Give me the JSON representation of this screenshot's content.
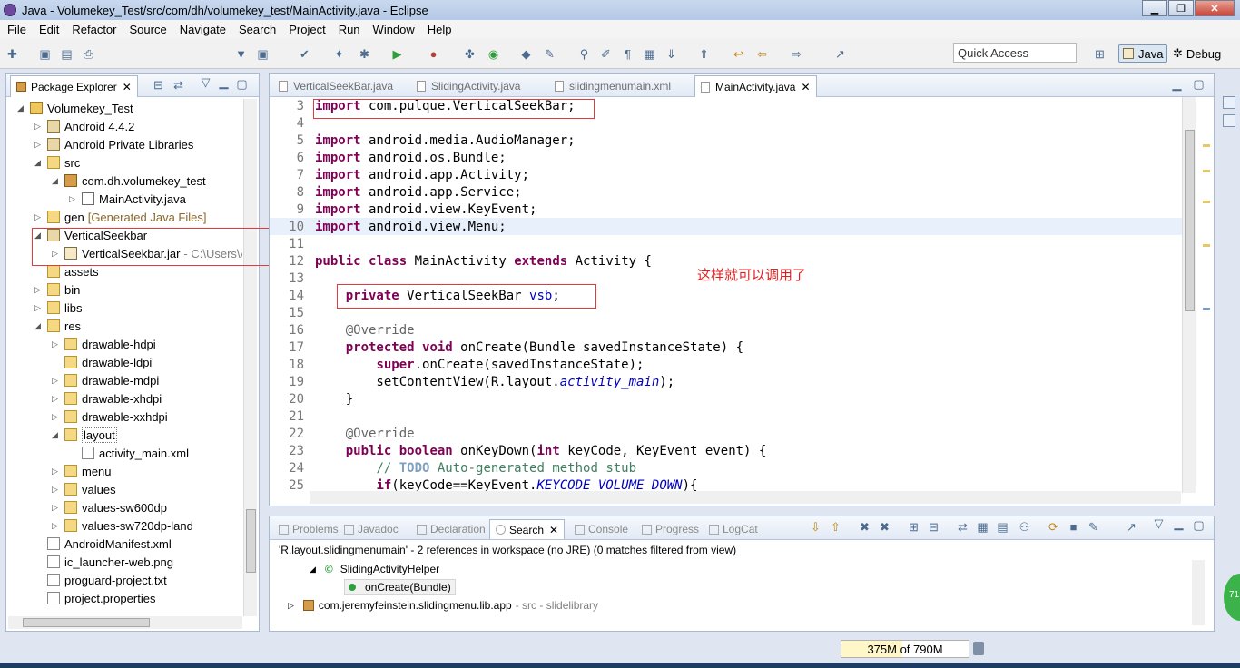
{
  "window": {
    "title": "Java - Volumekey_Test/src/com/dh/volumekey_test/MainActivity.java - Eclipse",
    "minimize": "▁",
    "maximize": "❐",
    "close": "✕"
  },
  "menu": [
    "File",
    "Edit",
    "Refactor",
    "Source",
    "Navigate",
    "Search",
    "Project",
    "Run",
    "Window",
    "Help"
  ],
  "toolbar": {
    "quick_access": "Quick Access",
    "perspectives": [
      "Java",
      "Debug"
    ]
  },
  "package_explorer": {
    "tab_label": "Package Explorer",
    "tree": [
      {
        "depth": 1,
        "arrow": "◢",
        "icon": "project-icon",
        "label": "Volumekey_Test",
        "suffix": ""
      },
      {
        "depth": 2,
        "arrow": "▷",
        "icon": "library-icon",
        "label": "Android 4.4.2",
        "suffix": ""
      },
      {
        "depth": 2,
        "arrow": "▷",
        "icon": "library-icon",
        "label": "Android Private Libraries",
        "suffix": ""
      },
      {
        "depth": 2,
        "arrow": "◢",
        "icon": "source-folder-icon",
        "label": "src",
        "suffix": ""
      },
      {
        "depth": 3,
        "arrow": "◢",
        "icon": "package-icon",
        "label": "com.dh.volumekey_test",
        "suffix": ""
      },
      {
        "depth": 4,
        "arrow": "▷",
        "icon": "java-file-icon",
        "label": "MainActivity.java",
        "suffix": ""
      },
      {
        "depth": 2,
        "arrow": "▷",
        "icon": "source-folder-icon",
        "label": "gen",
        "suffix": "[Generated Java Files]"
      },
      {
        "depth": 2,
        "arrow": "◢",
        "icon": "library-icon",
        "label": "VerticalSeekbar",
        "suffix": ""
      },
      {
        "depth": 3,
        "arrow": "▷",
        "icon": "jar-icon",
        "label": "VerticalSeekbar.jar",
        "suffix": "- C:\\Users\\Administrator\\Desktop"
      },
      {
        "depth": 2,
        "arrow": "",
        "icon": "folder-icon",
        "label": "assets",
        "suffix": ""
      },
      {
        "depth": 2,
        "arrow": "▷",
        "icon": "folder-icon",
        "label": "bin",
        "suffix": ""
      },
      {
        "depth": 2,
        "arrow": "▷",
        "icon": "folder-icon",
        "label": "libs",
        "suffix": ""
      },
      {
        "depth": 2,
        "arrow": "◢",
        "icon": "folder-icon",
        "label": "res",
        "suffix": ""
      },
      {
        "depth": 3,
        "arrow": "▷",
        "icon": "folder-icon",
        "label": "drawable-hdpi",
        "suffix": ""
      },
      {
        "depth": 3,
        "arrow": "",
        "icon": "folder-icon",
        "label": "drawable-ldpi",
        "suffix": ""
      },
      {
        "depth": 3,
        "arrow": "▷",
        "icon": "folder-icon",
        "label": "drawable-mdpi",
        "suffix": ""
      },
      {
        "depth": 3,
        "arrow": "▷",
        "icon": "folder-icon",
        "label": "drawable-xhdpi",
        "suffix": ""
      },
      {
        "depth": 3,
        "arrow": "▷",
        "icon": "folder-icon",
        "label": "drawable-xxhdpi",
        "suffix": ""
      },
      {
        "depth": 3,
        "arrow": "◢",
        "icon": "folder-icon",
        "label": "layout",
        "suffix": ""
      },
      {
        "depth": 4,
        "arrow": "",
        "icon": "xml-file-icon",
        "label": "activity_main.xml",
        "suffix": ""
      },
      {
        "depth": 3,
        "arrow": "▷",
        "icon": "folder-icon",
        "label": "menu",
        "suffix": ""
      },
      {
        "depth": 3,
        "arrow": "▷",
        "icon": "folder-icon",
        "label": "values",
        "suffix": ""
      },
      {
        "depth": 3,
        "arrow": "▷",
        "icon": "folder-icon",
        "label": "values-sw600dp",
        "suffix": ""
      },
      {
        "depth": 3,
        "arrow": "▷",
        "icon": "folder-icon",
        "label": "values-sw720dp-land",
        "suffix": ""
      },
      {
        "depth": 2,
        "arrow": "",
        "icon": "xml-file-icon",
        "label": "AndroidManifest.xml",
        "suffix": ""
      },
      {
        "depth": 2,
        "arrow": "",
        "icon": "image-file-icon",
        "label": "ic_launcher-web.png",
        "suffix": ""
      },
      {
        "depth": 2,
        "arrow": "",
        "icon": "text-file-icon",
        "label": "proguard-project.txt",
        "suffix": ""
      },
      {
        "depth": 2,
        "arrow": "",
        "icon": "text-file-icon",
        "label": "project.properties",
        "suffix": ""
      }
    ]
  },
  "editor": {
    "tabs": [
      {
        "label": "VerticalSeekBar.java",
        "active": false
      },
      {
        "label": "SlidingActivity.java",
        "active": false
      },
      {
        "label": "slidingmenumain.xml",
        "active": false
      },
      {
        "label": "MainActivity.java",
        "active": true
      }
    ],
    "annotation_note": "这样就可以调用了",
    "lines": [
      {
        "n": "3",
        "html": "<span class='kw'>import</span> com.pulque.VerticalSeekBar;"
      },
      {
        "n": "4",
        "html": ""
      },
      {
        "n": "5",
        "html": "<span class='kw'>import</span> android.media.AudioManager;"
      },
      {
        "n": "6",
        "html": "<span class='kw'>import</span> android.os.Bundle;"
      },
      {
        "n": "7",
        "html": "<span class='kw'>import</span> android.app.Activity;"
      },
      {
        "n": "8",
        "html": "<span class='kw'>import</span> android.app.Service;"
      },
      {
        "n": "9",
        "html": "<span class='kw'>import</span> android.view.KeyEvent;"
      },
      {
        "n": "10",
        "html": "<span class='kw'>import</span> android.view.Menu;"
      },
      {
        "n": "11",
        "html": ""
      },
      {
        "n": "12",
        "html": "<span class='kw'>public</span> <span class='kw'>class</span> MainActivity <span class='kw'>extends</span> Activity {"
      },
      {
        "n": "13",
        "html": ""
      },
      {
        "n": "14",
        "html": "    <span class='kw'>private</span> VerticalSeekBar <span class='field'>vsb</span>;"
      },
      {
        "n": "15",
        "html": ""
      },
      {
        "n": "16",
        "html": "    <span class='ann'>@Override</span>"
      },
      {
        "n": "17",
        "html": "    <span class='kw'>protected</span> <span class='kw'>void</span> onCreate(Bundle savedInstanceState) {"
      },
      {
        "n": "18",
        "html": "        <span class='kw'>super</span>.onCreate(savedInstanceState);"
      },
      {
        "n": "19",
        "html": "        setContentView(R.layout.<span class='ital'>activity_main</span>);"
      },
      {
        "n": "20",
        "html": "    }"
      },
      {
        "n": "21",
        "html": ""
      },
      {
        "n": "22",
        "html": "    <span class='ann'>@Override</span>"
      },
      {
        "n": "23",
        "html": "    <span class='kw'>public</span> <span class='kw'>boolean</span> onKeyDown(<span class='kw'>int</span> keyCode, KeyEvent event) {"
      },
      {
        "n": "24",
        "html": "        <span class='cmt'>// <span class='todo'>TODO</span> Auto-generated method stub</span>"
      },
      {
        "n": "25",
        "html": "        <span class='kw'>if</span>(keyCode==KeyEvent.<span class='ital'>KEYCODE_VOLUME_DOWN</span>){"
      }
    ]
  },
  "search_view": {
    "tabs": [
      {
        "label": "Problems",
        "active": false
      },
      {
        "label": "Javadoc",
        "active": false
      },
      {
        "label": "Declaration",
        "active": false
      },
      {
        "label": "Search",
        "active": true
      },
      {
        "label": "Console",
        "active": false
      },
      {
        "label": "Progress",
        "active": false
      },
      {
        "label": "LogCat",
        "active": false
      }
    ],
    "summary": "'R.layout.slidingmenumain' - 2 references in workspace (no JRE) (0 matches filtered from view)",
    "results": [
      {
        "label": "SlidingActivityHelper",
        "suffix": ""
      },
      {
        "label": "onCreate(Bundle)",
        "suffix": ""
      },
      {
        "label": "com.jeremyfeinstein.slidingmenu.lib.app",
        "suffix": "- src - slidelibrary"
      }
    ]
  },
  "status": {
    "memory": "375M of 790M",
    "memory_used_fraction": 0.47,
    "badge": "71"
  }
}
